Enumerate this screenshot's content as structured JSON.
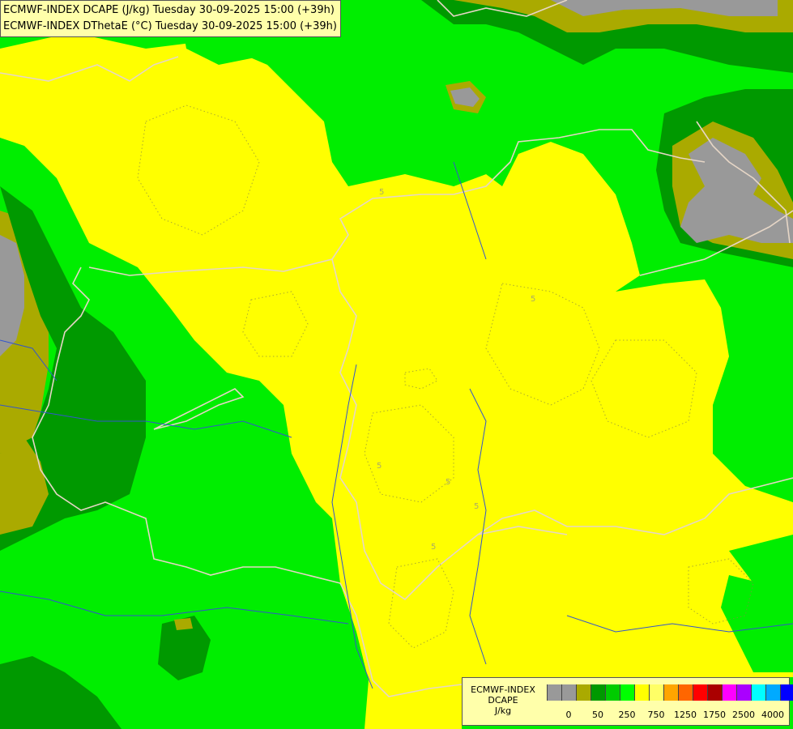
{
  "map": {
    "title_line1": "ECMWF-INDEX DCAPE (J/kg) Tuesday 30-09-2025 15:00 (+39h)",
    "title_line2": "ECMWF-INDEX DThetaE (°C) Tuesday 30-09-2025 15:00 (+39h)",
    "contour_labels": [
      "5",
      "5",
      "5",
      "5",
      "5",
      "5"
    ]
  },
  "legend": {
    "line1": "ECMWF-INDEX",
    "line2": "DCAPE",
    "line3": "J/kg",
    "colors": [
      "#999999",
      "#999999",
      "#aaaa00",
      "#009900",
      "#00cc00",
      "#00ff00",
      "#ffff00",
      "#ffff66",
      "#ffa500",
      "#ff6600",
      "#ff0000",
      "#aa0000",
      "#ff00ff",
      "#aa00ff",
      "#00ffff",
      "#00aaff",
      "#0000ff",
      "#000099"
    ],
    "tick_labels": [
      "0",
      "50",
      "250",
      "750",
      "1250",
      "1750",
      "2500",
      "4000"
    ]
  },
  "palette": {
    "gray": "#999999",
    "olive": "#aaaa00",
    "dark_green": "#009900",
    "medium_green": "#00cc00",
    "light_green": "#00ee00",
    "yellow": "#ffff00",
    "border_line": "#e0d0c0",
    "river": "#3355cc"
  }
}
